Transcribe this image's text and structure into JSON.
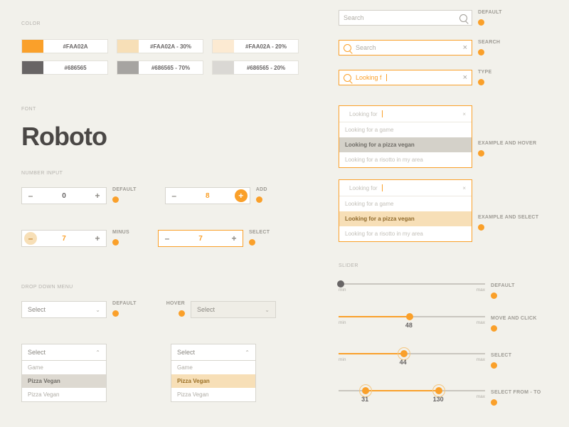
{
  "sections": {
    "color": "COLOR",
    "font": "FONT",
    "number": "NUMBER INPUT",
    "dropdown": "DROP DOWN MENU",
    "slider": "SLIDER"
  },
  "colors": {
    "row1": [
      {
        "hex": "#FAA02A",
        "label": "#FAA02A"
      },
      {
        "hex": "#F7DFB7",
        "label": "#FAA02A - 30%"
      },
      {
        "hex": "#FCEAD2",
        "label": "#FAA02A - 20%"
      }
    ],
    "row2": [
      {
        "hex": "#686565",
        "label": "#686565"
      },
      {
        "hex": "#A6A4A1",
        "label": "#686565 - 70%"
      },
      {
        "hex": "#DAD8D4",
        "label": "#686565 - 20%"
      }
    ]
  },
  "font_name": "Roboto",
  "number": {
    "default": {
      "value": "0",
      "label": "DEFAULT"
    },
    "add": {
      "value": "8",
      "label": "ADD"
    },
    "minus": {
      "value": "7",
      "label": "MINUS"
    },
    "select": {
      "value": "7",
      "label": "SELECT"
    }
  },
  "dropdown": {
    "placeholder": "Select",
    "labels": {
      "default": "DEFAULT",
      "hover": "HOVER"
    },
    "items": [
      "Game",
      "Pizza Vegan",
      "Pizza Vegan"
    ]
  },
  "search": {
    "labels": {
      "default": "DEFAULT",
      "search": "SEARCH",
      "type": "TYPE",
      "example_hover": "EXAMPLE AND HOVER",
      "example_select": "EXAMPLE AND SELECT"
    },
    "placeholder": "Search",
    "typing_short": "Looking f",
    "typing_long": "Looking for",
    "suggest": [
      "Looking for a game",
      "Looking for a pizza vegan",
      "Looking for a risotto in my area"
    ]
  },
  "slider": {
    "min": "min",
    "max": "max",
    "labels": {
      "default": "DEFAULT",
      "move": "MOVE AND CLICK",
      "select": "SELECT",
      "range": "SELECT FROM - TO"
    },
    "move_val": "48",
    "select_val": "44",
    "range_from": "31",
    "range_to": "130"
  }
}
